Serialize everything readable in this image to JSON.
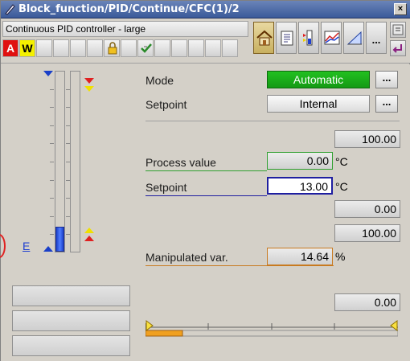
{
  "window": {
    "title": "Block_function/PID/Continue/CFC(1)/2",
    "close_label": "×"
  },
  "header": {
    "faceplate_name": "Continuous PID controller - large",
    "status": {
      "alarm_label": "A",
      "warning_label": "W"
    },
    "views": [
      "home-icon",
      "notes-icon",
      "limits-icon",
      "trend-icon",
      "ramp-icon"
    ],
    "more_label": "..."
  },
  "bargraph": {
    "level_fraction": 0.14,
    "e_label": "E"
  },
  "controls": {
    "mode_label": "Mode",
    "mode_value": "Automatic",
    "setpoint_source_label": "Setpoint",
    "setpoint_source_value": "Internal",
    "more_label": "..."
  },
  "values": {
    "high_limit": "100.00",
    "process_value_label": "Process value",
    "process_value": "0.00",
    "setpoint_label": "Setpoint",
    "setpoint_value": "13.00",
    "unit_degc": "°C",
    "low_limit": "0.00",
    "mv_high": "100.00",
    "manipulated_label": "Manipulated var.",
    "manipulated_value": "14.64",
    "unit_percent": "%",
    "mv_low": "0.00"
  },
  "colors": {
    "automatic": "#22c020",
    "process_value_line": "#30a030",
    "setpoint_line": "#1e1ea0",
    "manipulated_line": "#c87a20"
  }
}
